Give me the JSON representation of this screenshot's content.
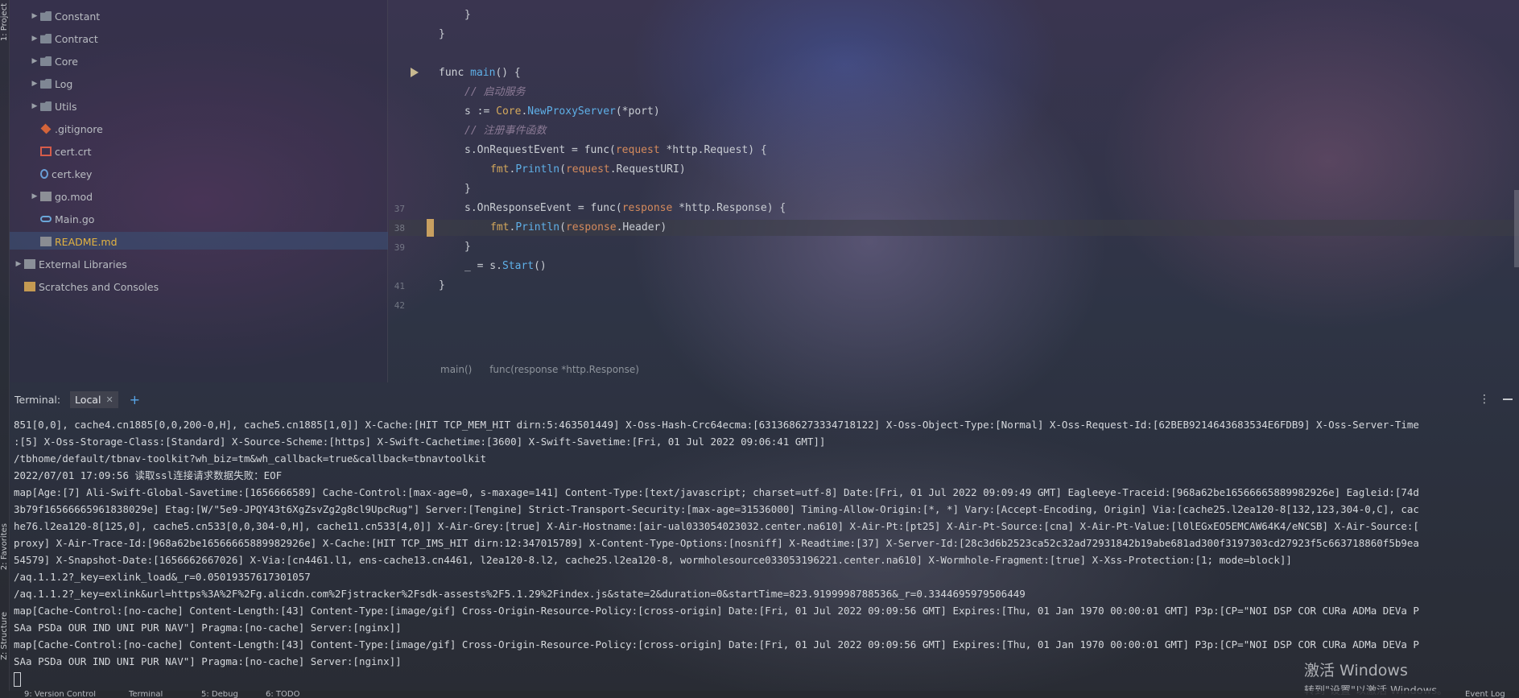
{
  "tool_strip": {
    "project_label": "1: Project",
    "favorites_label": "2: Favorites",
    "structure_label": "Z: Structure"
  },
  "project_tree": {
    "items": [
      {
        "name": "Constant",
        "type": "folder",
        "expandable": true
      },
      {
        "name": "Contract",
        "type": "folder",
        "expandable": true
      },
      {
        "name": "Core",
        "type": "folder",
        "expandable": true
      },
      {
        "name": "Log",
        "type": "folder",
        "expandable": true
      },
      {
        "name": "Utils",
        "type": "folder",
        "expandable": true
      },
      {
        "name": ".gitignore",
        "type": "git-file"
      },
      {
        "name": "cert.crt",
        "type": "crt-file"
      },
      {
        "name": "cert.key",
        "type": "key-file"
      },
      {
        "name": "go.mod",
        "type": "mod-file",
        "expandable": true
      },
      {
        "name": "Main.go",
        "type": "go-file"
      },
      {
        "name": "README.md",
        "type": "md-file",
        "selected": true,
        "color": "#e3b341"
      },
      {
        "name": "External Libraries",
        "type": "library",
        "expandable": true
      },
      {
        "name": "Scratches and Consoles",
        "type": "scratches"
      }
    ]
  },
  "editor": {
    "line_numbers": [
      "",
      "",
      "",
      "",
      "",
      "",
      "",
      "",
      "",
      "37",
      "38",
      "39",
      "",
      "41",
      "42"
    ],
    "breadcrumb": [
      "main()",
      "func(response *http.Response)"
    ]
  },
  "terminal": {
    "title": "Terminal:",
    "tab_label": "Local",
    "lines": [
      "851[0,0], cache4.cn1885[0,0,200-0,H], cache5.cn1885[1,0]] X-Cache:[HIT TCP_MEM_HIT dirn:5:463501449] X-Oss-Hash-Crc64ecma:[6313686273334718122] X-Oss-Object-Type:[Normal] X-Oss-Request-Id:[62BEB9214643683534E6FDB9] X-Oss-Server-Time",
      ":[5] X-Oss-Storage-Class:[Standard] X-Source-Scheme:[https] X-Swift-Cachetime:[3600] X-Swift-Savetime:[Fri, 01 Jul 2022 09:06:41 GMT]]",
      "/tbhome/default/tbnav-toolkit?wh_biz=tm&wh_callback=true&callback=tbnavtoolkit",
      "2022/07/01 17:09:56 读取ssl连接请求数据失败：EOF",
      "map[Age:[7] Ali-Swift-Global-Savetime:[1656666589] Cache-Control:[max-age=0, s-maxage=141] Content-Type:[text/javascript; charset=utf-8] Date:[Fri, 01 Jul 2022 09:09:49 GMT] Eagleeye-Traceid:[968a62be16566665889982926e] Eagleid:[74d",
      "3b79f16566665961838029e] Etag:[W/\"5e9-JPQY43t6XgZsvZg2g8cl9UpcRug\"] Server:[Tengine] Strict-Transport-Security:[max-age=31536000] Timing-Allow-Origin:[*, *] Vary:[Accept-Encoding, Origin] Via:[cache25.l2ea120-8[132,123,304-0,C], cac",
      "he76.l2ea120-8[125,0], cache5.cn533[0,0,304-0,H], cache11.cn533[4,0]] X-Air-Grey:[true] X-Air-Hostname:[air-ual033054023032.center.na610] X-Air-Pt:[pt25] X-Air-Pt-Source:[cna] X-Air-Pt-Value:[l0lEGxEO5EMCAW64K4/eNCSB] X-Air-Source:[",
      "proxy] X-Air-Trace-Id:[968a62be16566665889982926e] X-Cache:[HIT TCP_IMS_HIT dirn:12:347015789] X-Content-Type-Options:[nosniff] X-Readtime:[37] X-Server-Id:[28c3d6b2523ca52c32ad72931842b19abe681ad300f3197303cd27923f5c663718860f5b9ea",
      "54579] X-Snapshot-Date:[1656662667026] X-Via:[cn4461.l1, ens-cache13.cn4461, l2ea120-8.l2, cache25.l2ea120-8, wormholesource033053196221.center.na610] X-Wormhole-Fragment:[true] X-Xss-Protection:[1; mode=block]]",
      "/aq.1.1.2?_key=exlink_load&_r=0.05019357617301057",
      "/aq.1.1.2?_key=exlink&url=https%3A%2F%2Fg.alicdn.com%2Fjstracker%2Fsdk-assests%2F5.1.29%2Findex.js&state=2&duration=0&startTime=823.9199998788536&_r=0.3344695979506449",
      "map[Cache-Control:[no-cache] Content-Length:[43] Content-Type:[image/gif] Cross-Origin-Resource-Policy:[cross-origin] Date:[Fri, 01 Jul 2022 09:09:56 GMT] Expires:[Thu, 01 Jan 1970 00:00:01 GMT] P3p:[CP=\"NOI DSP COR CURa ADMa DEVa P",
      "SAa PSDa OUR IND UNI PUR NAV\"] Pragma:[no-cache] Server:[nginx]]",
      "map[Cache-Control:[no-cache] Content-Length:[43] Content-Type:[image/gif] Cross-Origin-Resource-Policy:[cross-origin] Date:[Fri, 01 Jul 2022 09:09:56 GMT] Expires:[Thu, 01 Jan 1970 00:00:01 GMT] P3p:[CP=\"NOI DSP COR CURa ADMa DEVa P",
      "SAa PSDa OUR IND UNI PUR NAV\"] Pragma:[no-cache] Server:[nginx]]"
    ]
  },
  "watermark": {
    "line1": "激活 Windows",
    "line2": "转到\"设置\"以激活 Windows。"
  },
  "statusbar": {
    "version_control": "9: Version Control",
    "terminal": "Terminal",
    "debug": "5: Debug",
    "todo": "6: TODO",
    "event_log": "Event Log"
  },
  "colors": {
    "accent_blue": "#58a6e8",
    "selected_row": "#3c4b6e",
    "bookmark": "#c8a060"
  }
}
